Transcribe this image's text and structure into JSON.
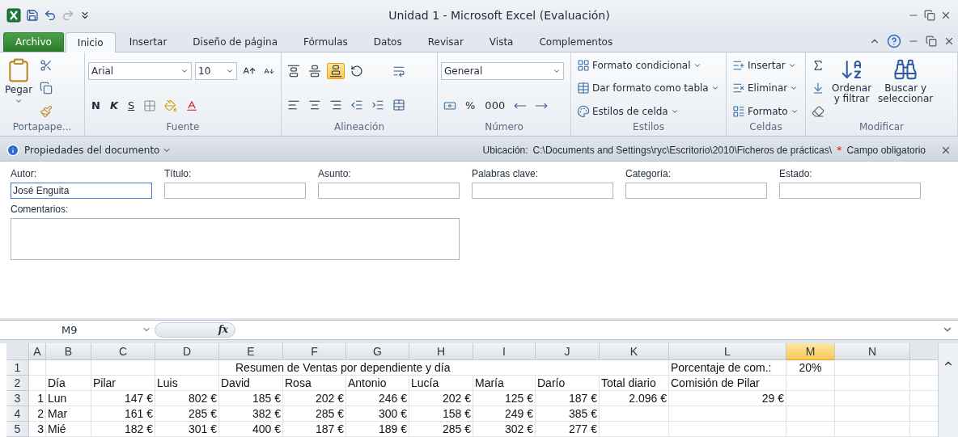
{
  "window": {
    "title": "Unidad 1  -  Microsoft Excel (Evaluación)"
  },
  "tabs": [
    {
      "label": "Archivo",
      "kind": "file",
      "selected": false
    },
    {
      "label": "Inicio",
      "kind": "tab",
      "selected": true
    },
    {
      "label": "Insertar",
      "kind": "tab",
      "selected": false
    },
    {
      "label": "Diseño de página",
      "kind": "tab",
      "selected": false
    },
    {
      "label": "Fórmulas",
      "kind": "tab",
      "selected": false
    },
    {
      "label": "Datos",
      "kind": "tab",
      "selected": false
    },
    {
      "label": "Revisar",
      "kind": "tab",
      "selected": false
    },
    {
      "label": "Vista",
      "kind": "tab",
      "selected": false
    },
    {
      "label": "Complementos",
      "kind": "tab",
      "selected": false
    }
  ],
  "ribbon": {
    "groups": [
      {
        "kind": "clipboard",
        "label": "Portapape...",
        "paste": "Pegar"
      },
      {
        "kind": "font",
        "label": "Fuente",
        "font": "Arial",
        "size": "10",
        "bold": "N",
        "italic": "K",
        "underline": "S"
      },
      {
        "kind": "alignment",
        "label": "Alineación",
        "vertical": [
          {
            "selected": false
          },
          {
            "selected": false
          },
          {
            "selected": true
          }
        ]
      },
      {
        "kind": "number",
        "label": "Número",
        "format": "General",
        "percent": "%",
        "thousands": "000"
      },
      {
        "kind": "styles",
        "label": "Estilos",
        "buttons": [
          "Formato condicional",
          "Dar formato como tabla",
          "Estilos de celda"
        ]
      },
      {
        "kind": "cells",
        "label": "Celdas",
        "buttons": [
          "Insertar",
          "Eliminar",
          "Formato"
        ]
      },
      {
        "kind": "editing",
        "label": "Modificar",
        "sort": [
          "Ordenar",
          "y filtrar"
        ],
        "find": [
          "Buscar y",
          "seleccionar"
        ]
      }
    ]
  },
  "document_properties": {
    "title": "Propiedades del documento",
    "location_label": "Ubicación:",
    "location": "C:\\Documents and Settings\\ryc\\Escritorio\\2010\\Ficheros de prácticas\\",
    "required_mark": "*",
    "required_note": "Campo obligatorio",
    "fields": [
      {
        "label": "Autor:",
        "value": "José Enguita",
        "focused": true
      },
      {
        "label": "Título:",
        "focused": false
      },
      {
        "label": "Asunto:",
        "focused": false
      },
      {
        "label": "Palabras clave:",
        "focused": false
      },
      {
        "label": "Categoría:",
        "focused": false
      },
      {
        "label": "Estado:",
        "focused": false
      }
    ],
    "comments_label": "Comentarios:"
  },
  "formula_bar": {
    "name_box": "M9",
    "fx": "fx"
  },
  "sheet": {
    "columns": [
      {
        "label": "A",
        "selected": false
      },
      {
        "label": "B",
        "selected": false
      },
      {
        "label": "C",
        "selected": false
      },
      {
        "label": "D",
        "selected": false
      },
      {
        "label": "E",
        "selected": false
      },
      {
        "label": "F",
        "selected": false
      },
      {
        "label": "G",
        "selected": false
      },
      {
        "label": "H",
        "selected": false
      },
      {
        "label": "I",
        "selected": false
      },
      {
        "label": "J",
        "selected": false
      },
      {
        "label": "K",
        "selected": false
      },
      {
        "label": "L",
        "selected": false
      },
      {
        "label": "M",
        "selected": true
      },
      {
        "label": "N",
        "selected": false
      }
    ],
    "rows": [
      {
        "header": "1",
        "cells": [
          "",
          "",
          "",
          "",
          {
            "text": "Resumen de Ventas por dependiente y día",
            "kind": "title"
          },
          "",
          "",
          "",
          "",
          "",
          "",
          {
            "text": "Porcentaje de com.:",
            "kind": "text"
          },
          {
            "text": "20%",
            "kind": "center"
          },
          null
        ]
      },
      {
        "header": "2",
        "cells": [
          null,
          {
            "text": "Día",
            "kind": "text"
          },
          {
            "text": "Pilar",
            "kind": "text"
          },
          {
            "text": "Luis",
            "kind": "text"
          },
          {
            "text": "David",
            "kind": "text"
          },
          {
            "text": "Rosa",
            "kind": "text"
          },
          {
            "text": "Antonio",
            "kind": "text"
          },
          {
            "text": "Lucía",
            "kind": "text"
          },
          {
            "text": "María",
            "kind": "text"
          },
          {
            "text": "Darío",
            "kind": "text"
          },
          {
            "text": "Total diario",
            "kind": "text"
          },
          {
            "text": "Comisión de Pilar",
            "kind": "text"
          },
          null,
          null
        ]
      },
      {
        "header": "3",
        "cells": [
          {
            "text": "1",
            "kind": "number"
          },
          {
            "text": "Lun",
            "kind": "text"
          },
          {
            "text": "147 €",
            "kind": "number"
          },
          {
            "text": "802 €",
            "kind": "number"
          },
          {
            "text": "185 €",
            "kind": "number"
          },
          {
            "text": "202 €",
            "kind": "number"
          },
          {
            "text": "246 €",
            "kind": "number"
          },
          {
            "text": "202 €",
            "kind": "number"
          },
          {
            "text": "125 €",
            "kind": "number"
          },
          {
            "text": "187 €",
            "kind": "number"
          },
          {
            "text": "2.096 €",
            "kind": "number"
          },
          {
            "text": "29 €",
            "kind": "number"
          },
          null,
          null
        ]
      },
      {
        "header": "4",
        "cells": [
          {
            "text": "2",
            "kind": "number"
          },
          {
            "text": "Mar",
            "kind": "text"
          },
          {
            "text": "161 €",
            "kind": "number"
          },
          {
            "text": "285 €",
            "kind": "number"
          },
          {
            "text": "382 €",
            "kind": "number"
          },
          {
            "text": "285 €",
            "kind": "number"
          },
          {
            "text": "300 €",
            "kind": "number"
          },
          {
            "text": "158 €",
            "kind": "number"
          },
          {
            "text": "249 €",
            "kind": "number"
          },
          {
            "text": "385 €",
            "kind": "number"
          },
          null,
          null,
          null,
          null
        ]
      },
      {
        "header": "5",
        "cells": [
          {
            "text": "3",
            "kind": "number"
          },
          {
            "text": "Mié",
            "kind": "text"
          },
          {
            "text": "182 €",
            "kind": "number"
          },
          {
            "text": "301 €",
            "kind": "number"
          },
          {
            "text": "400 €",
            "kind": "number"
          },
          {
            "text": "187 €",
            "kind": "number"
          },
          {
            "text": "189 €",
            "kind": "number"
          },
          {
            "text": "285 €",
            "kind": "number"
          },
          {
            "text": "302 €",
            "kind": "number"
          },
          {
            "text": "277 €",
            "kind": "number"
          },
          null,
          null,
          null,
          null
        ]
      }
    ]
  }
}
